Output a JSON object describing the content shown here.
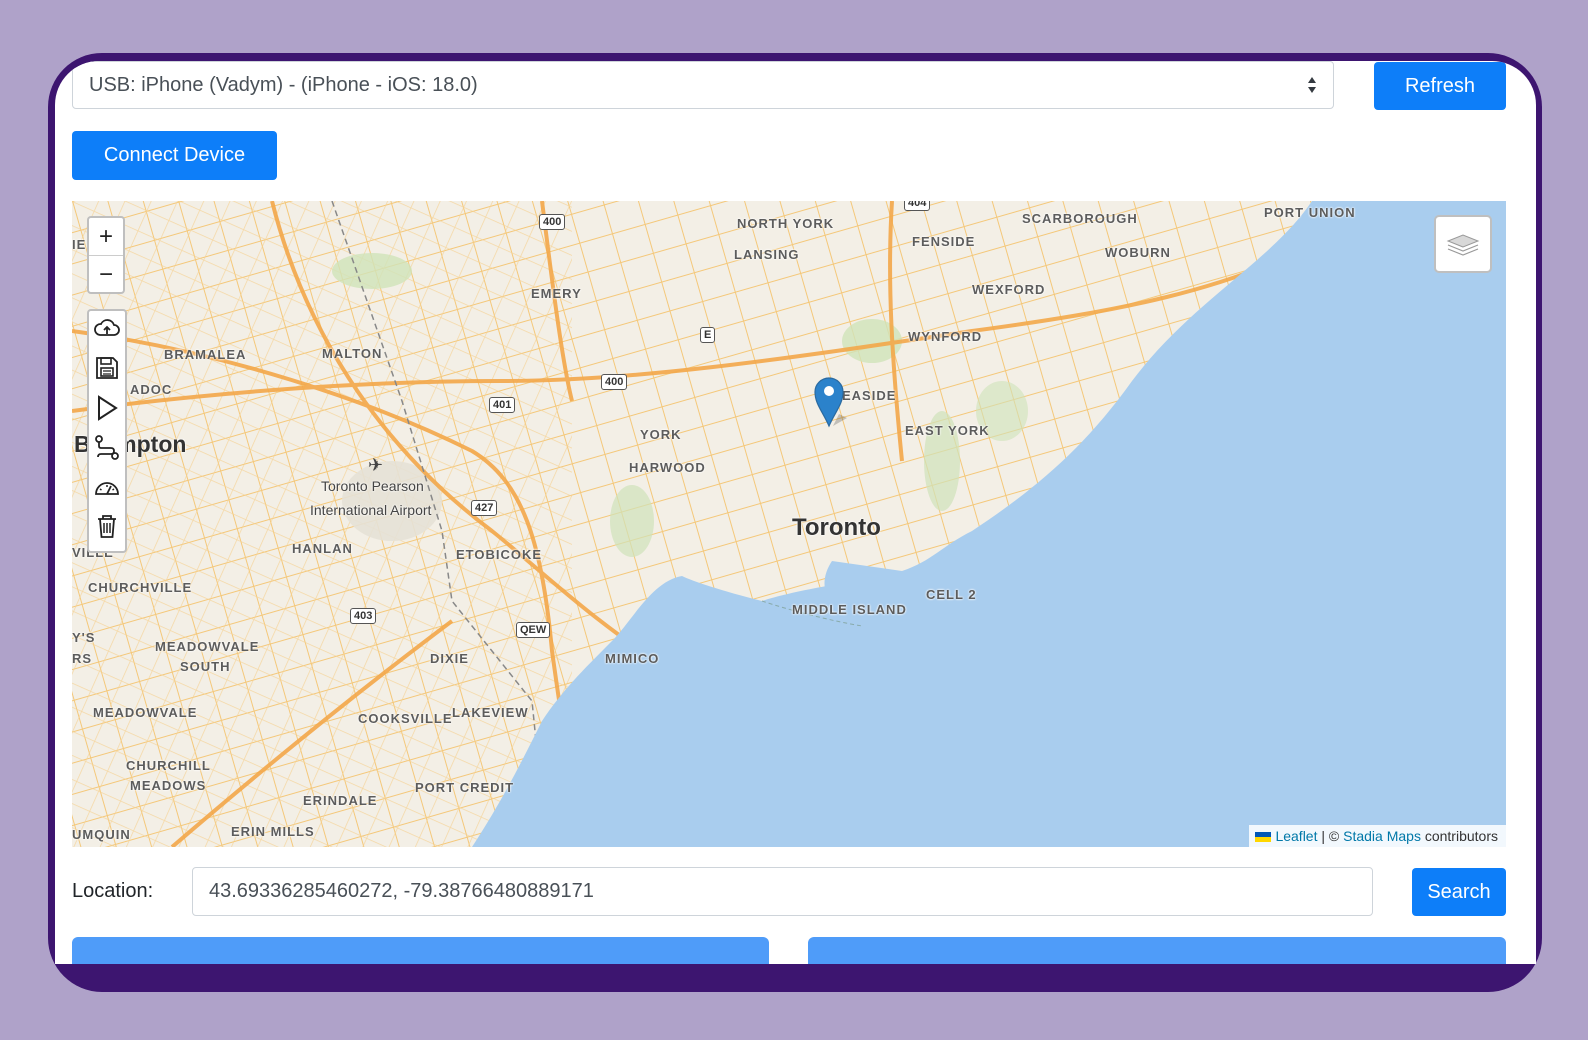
{
  "device_select": {
    "selected": "USB: iPhone (Vadym) - (iPhone - iOS: 18.0)",
    "caret_icon": "sort-caret-icon"
  },
  "buttons": {
    "refresh": "Refresh",
    "connect": "Connect Device",
    "search": "Search"
  },
  "map": {
    "zoom_in": "+",
    "zoom_out": "−",
    "tools": [
      "cloud-upload-icon",
      "save-icon",
      "play-icon",
      "route-icon",
      "speedometer-icon",
      "trash-icon"
    ],
    "layers_icon": "layers-icon",
    "marker_icon": "map-marker-icon",
    "labels": {
      "north_york": "NORTH YORK",
      "scarborough": "SCARBOROUGH",
      "port_union": "PORT UNION",
      "fenside": "FENSIDE",
      "woburn": "WOBURN",
      "lansing": "LANSING",
      "emery": "EMERY",
      "wexford": "WEXFORD",
      "wynford": "WYNFORD",
      "bramalea": "BRAMALEA",
      "malton": "MALTON",
      "adoc": "ADOC",
      "leaside": "EASIDE",
      "brampton": "B    mpton",
      "york": "YORK",
      "east_york": "EAST YORK",
      "harwood": "HARWOOD",
      "pearson": "Toronto Pearson",
      "pearson2": "International Airport",
      "toronto": "Toronto",
      "hanlan": "HANLAN",
      "etobicoke": "ETOBICOKE",
      "ville": "VILLE",
      "churchville": "CHURCHVILLE",
      "middle_island": "MIDDLE ISLAND",
      "cell2": "CELL 2",
      "ys": "Y'S",
      "rs": "RS",
      "meadowvale_south": "MEADOWVALE",
      "meadowvale_south2": "SOUTH",
      "dixie": "DIXIE",
      "mimico": "MIMICO",
      "meadowvale": "MEADOWVALE",
      "cooksville": "COOKSVILLE",
      "lakeview": "LAKEVIEW",
      "churchill": "CHURCHILL",
      "churchill2": "MEADOWS",
      "port_credit": "PORT CREDIT",
      "erindale": "ERINDALE",
      "umquin": "UMQUIN",
      "erin_mills": "ERIN MILLS",
      "ie": "IE"
    },
    "shields": {
      "s400a": "400",
      "s404": "404",
      "s400b": "400",
      "s401": "401",
      "s427": "427",
      "s403": "403",
      "qew": "QEW",
      "e": "E"
    },
    "attribution": {
      "leaflet": "Leaflet",
      "sep": " | © ",
      "stadia": "Stadia Maps",
      "contrib": " contributors"
    },
    "colors": {
      "water": "#a9cdee",
      "land": "#f3efe6",
      "roads": "#f5c36f",
      "park": "#cfe3b9",
      "marker": "#2b82cb"
    }
  },
  "location": {
    "label": "Location:",
    "value": "43.69336285460272, -79.38766480889171"
  },
  "colors": {
    "primary": "#0d7ef9",
    "frame": "#3d1570",
    "background": "#afa2c9"
  }
}
